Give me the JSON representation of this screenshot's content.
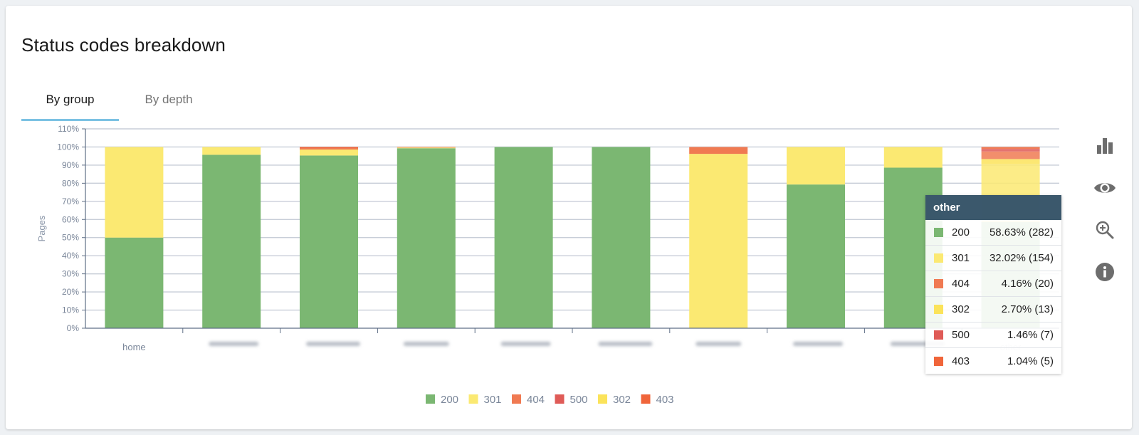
{
  "card": {
    "title": "Status codes breakdown"
  },
  "tabs": [
    {
      "label": "By group",
      "active": true
    },
    {
      "label": "By depth",
      "active": false
    }
  ],
  "colors": {
    "200": "#7bb772",
    "301": "#fbe972",
    "404": "#f07a52",
    "500": "#df5b57",
    "302": "#fbe35a",
    "403": "#f0653a",
    "grid": "#c8ced8",
    "axis": "#5f6f86",
    "tab_accent": "#7cc2e3",
    "tooltip_header": "#26465c",
    "icon": "#6d6d6d"
  },
  "toolbar": [
    {
      "icon": "bar-chart-icon",
      "name": "chart-type-button"
    },
    {
      "icon": "eye-icon",
      "name": "visibility-button"
    },
    {
      "icon": "zoom-in-icon",
      "name": "zoom-button"
    },
    {
      "icon": "info-icon",
      "name": "info-button"
    }
  ],
  "chart_data": {
    "type": "bar",
    "stacked": true,
    "title": "",
    "xlabel": "",
    "ylabel": "Pages",
    "ylim": [
      0,
      110
    ],
    "yticks": [
      "0%",
      "10%",
      "20%",
      "30%",
      "40%",
      "50%",
      "60%",
      "70%",
      "80%",
      "90%",
      "100%",
      "110%"
    ],
    "grid": true,
    "legend_position": "bottom",
    "categories": [
      "home",
      "",
      "",
      "",
      "",
      "",
      "",
      "",
      "",
      "other"
    ],
    "category_labels_redacted": [
      false,
      true,
      true,
      true,
      true,
      true,
      true,
      true,
      true,
      false
    ],
    "series": [
      {
        "name": "200",
        "values": [
          50,
          95.7,
          95.3,
          99.3,
          100,
          100,
          0,
          79.3,
          88.6,
          58.63
        ]
      },
      {
        "name": "301",
        "values": [
          50,
          4.3,
          3.3,
          0.4,
          0,
          0,
          96.2,
          20.7,
          11.4,
          32.02
        ]
      },
      {
        "name": "404",
        "values": [
          0,
          0,
          0.8,
          0.3,
          0,
          0,
          3.8,
          0,
          0,
          4.16
        ]
      },
      {
        "name": "500",
        "values": [
          0,
          0,
          0,
          0,
          0,
          0,
          0,
          0,
          0,
          1.46
        ]
      },
      {
        "name": "302",
        "values": [
          0,
          0,
          0,
          0,
          0,
          0,
          0,
          0,
          0,
          2.7
        ]
      },
      {
        "name": "403",
        "values": [
          0,
          0,
          0.6,
          0,
          0,
          0,
          0,
          0,
          0,
          1.04
        ]
      }
    ],
    "stack_order": [
      "200",
      "301",
      "302",
      "404",
      "500",
      "403"
    ],
    "highlighted_category": "other",
    "legend": [
      "200",
      "301",
      "404",
      "500",
      "302",
      "403"
    ]
  },
  "tooltip": {
    "title": "other",
    "rows": [
      {
        "code": "200",
        "value": "58.63% (282)"
      },
      {
        "code": "301",
        "value": "32.02% (154)"
      },
      {
        "code": "404",
        "value": "4.16% (20)"
      },
      {
        "code": "302",
        "value": "2.70% (13)"
      },
      {
        "code": "500",
        "value": "1.46% (7)"
      },
      {
        "code": "403",
        "value": "1.04% (5)"
      }
    ]
  }
}
